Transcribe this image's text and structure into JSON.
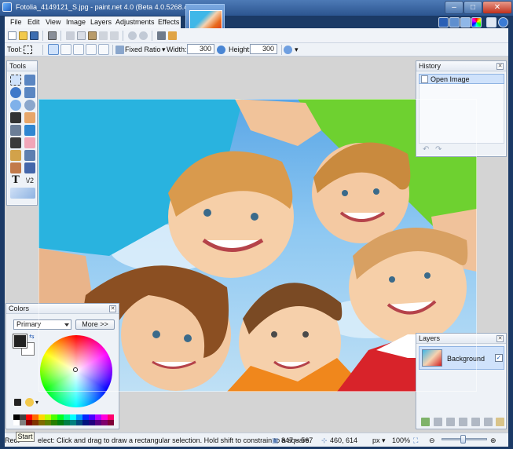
{
  "window": {
    "title": "Fotolia_4149121_S.jpg - paint.net 4.0 (Beta 4.0.5268.42065)",
    "min_glyph": "–",
    "max_glyph": "□",
    "close_glyph": "✕"
  },
  "menu": {
    "items": [
      "File",
      "Edit",
      "View",
      "Image",
      "Layers",
      "Adjustments",
      "Effects"
    ]
  },
  "toolbar": {
    "tool_label": "Tool:",
    "fixed_ratio_label": "Fixed Ratio",
    "width_label": "Width:",
    "width_value": "300",
    "height_label": "Height:",
    "height_value": "300"
  },
  "tools_panel": {
    "title": "Tools",
    "close_glyph": "✕"
  },
  "history_panel": {
    "title": "History",
    "close_glyph": "✕",
    "items": [
      {
        "label": "Open Image"
      }
    ]
  },
  "colors_panel": {
    "title": "Colors",
    "close_glyph": "✕",
    "mode_selected": "Primary",
    "more_button": "More >>",
    "primary_color": "#222222",
    "secondary_color": "#ffffff",
    "palette": [
      "#000000",
      "#404040",
      "#ff0000",
      "#ff6a00",
      "#ffd800",
      "#b6ff00",
      "#4cff00",
      "#00ff21",
      "#00ff90",
      "#00ffff",
      "#0094ff",
      "#0026ff",
      "#4800ff",
      "#b200ff",
      "#ff00dc",
      "#ff006e",
      "#ffffff",
      "#808080",
      "#7f0000",
      "#7f3300",
      "#7f6a00",
      "#5b7f00",
      "#267f00",
      "#007f0e",
      "#007f46",
      "#007f7f",
      "#004a7f",
      "#00137f",
      "#21007f",
      "#57007f",
      "#7f006e",
      "#7f0037"
    ]
  },
  "layers_panel": {
    "title": "Layers",
    "close_glyph": "✕",
    "layers": [
      {
        "name": "Background",
        "visible": true,
        "check_glyph": "✓"
      }
    ]
  },
  "statusbar": {
    "tooltip": "Start",
    "hint_prefix": "Rect",
    "hint": "elect: Click and drag to draw a rectangular selection. Hold shift to constrain to a square.",
    "image_size": "847 × 567",
    "cursor_pos": "460, 614",
    "unit": "px",
    "zoom": "100%"
  },
  "colors": {
    "titlebar": "#2c5590",
    "selection_fill": "#cfe2fb",
    "workspace": "#d4d4d4"
  }
}
